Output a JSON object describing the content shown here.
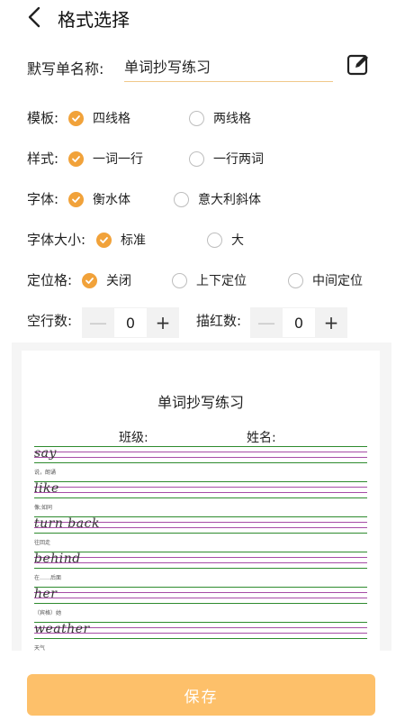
{
  "header": {
    "title": "格式选择"
  },
  "name_field": {
    "label": "默写单名称:",
    "value": "单词抄写练习"
  },
  "rows": [
    {
      "label": "模板:",
      "options": [
        {
          "text": "四线格",
          "checked": true
        },
        {
          "text": "两线格",
          "checked": false
        }
      ]
    },
    {
      "label": "样式:",
      "options": [
        {
          "text": "一词一行",
          "checked": true
        },
        {
          "text": "一行两词",
          "checked": false
        }
      ]
    },
    {
      "label": "字体:",
      "options": [
        {
          "text": "衡水体",
          "checked": true
        },
        {
          "text": "意大利斜体",
          "checked": false
        }
      ]
    },
    {
      "label": "字体大小:",
      "options": [
        {
          "text": "标准",
          "checked": true
        },
        {
          "text": "大",
          "checked": false
        }
      ]
    },
    {
      "label": "定位格:",
      "options": [
        {
          "text": "关闭",
          "checked": true
        },
        {
          "text": "上下定位",
          "checked": false
        },
        {
          "text": "中间定位",
          "checked": false
        }
      ]
    }
  ],
  "empty_rows": {
    "label": "空行数:",
    "value": "0",
    "minus": "—",
    "plus": "+"
  },
  "trace_count": {
    "label": "描红数:",
    "value": "0",
    "minus": "—",
    "plus": "+"
  },
  "preview": {
    "title": "单词抄写练习",
    "class_label": "班级:",
    "name_label": "姓名:",
    "words": [
      {
        "word": "say",
        "meaning": "说，朗诵"
      },
      {
        "word": "like",
        "meaning": "像;如同"
      },
      {
        "word": "turn back",
        "meaning": "往回走"
      },
      {
        "word": "behind",
        "meaning": "在……后面"
      },
      {
        "word": "her",
        "meaning": "（宾格）她"
      },
      {
        "word": "weather",
        "meaning": "天气"
      }
    ]
  },
  "save_button": {
    "label": "保存"
  },
  "colors": {
    "accent": "#f1a23a",
    "save_bg": "#fdc06a",
    "underline": "#f0c88a",
    "line_green": "#2e8b2e",
    "line_purple": "#a64ca6"
  },
  "icons": {
    "back": "chevron-left-icon",
    "edit": "edit-icon",
    "check": "check-icon"
  }
}
